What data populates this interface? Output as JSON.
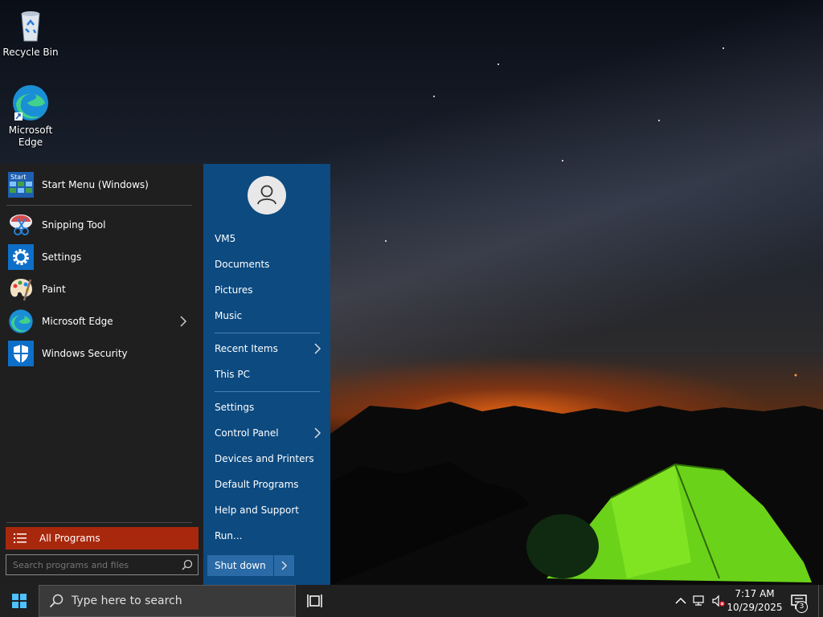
{
  "desktop": {
    "icons": [
      {
        "label": "Recycle Bin",
        "icon": "recycle-bin-icon"
      },
      {
        "label": "Microsoft Edge",
        "icon": "edge-icon"
      }
    ]
  },
  "start_menu": {
    "header_app": {
      "label": "Start Menu (Windows)",
      "icon": "start-menu-app-icon"
    },
    "pinned": [
      {
        "label": "Snipping Tool",
        "icon": "snipping-tool-icon"
      },
      {
        "label": "Settings",
        "icon": "settings-gear-icon"
      },
      {
        "label": "Paint",
        "icon": "paint-palette-icon"
      },
      {
        "label": "Microsoft Edge",
        "icon": "edge-icon",
        "submenu": true
      },
      {
        "label": "Windows Security",
        "icon": "shield-icon"
      }
    ],
    "all_programs_label": "All Programs",
    "search_placeholder": "Search programs and files",
    "right": {
      "user": "VM5",
      "items_a": [
        "Documents",
        "Pictures",
        "Music"
      ],
      "items_b": [
        {
          "label": "Recent Items",
          "submenu": true
        },
        {
          "label": "This PC",
          "submenu": false
        }
      ],
      "items_c": [
        {
          "label": "Settings",
          "submenu": false
        },
        {
          "label": "Control Panel",
          "submenu": true
        },
        {
          "label": "Devices and Printers",
          "submenu": false
        },
        {
          "label": "Default Programs",
          "submenu": false
        },
        {
          "label": "Help and Support",
          "submenu": false
        },
        {
          "label": "Run...",
          "submenu": false
        }
      ],
      "shutdown_label": "Shut down"
    },
    "accent_color": "#a8280d",
    "right_pane_color": "#0c4a80"
  },
  "taskbar": {
    "search_placeholder": "Type here to search",
    "time": "7:17 AM",
    "date": "10/29/2025",
    "notification_count": "3"
  }
}
